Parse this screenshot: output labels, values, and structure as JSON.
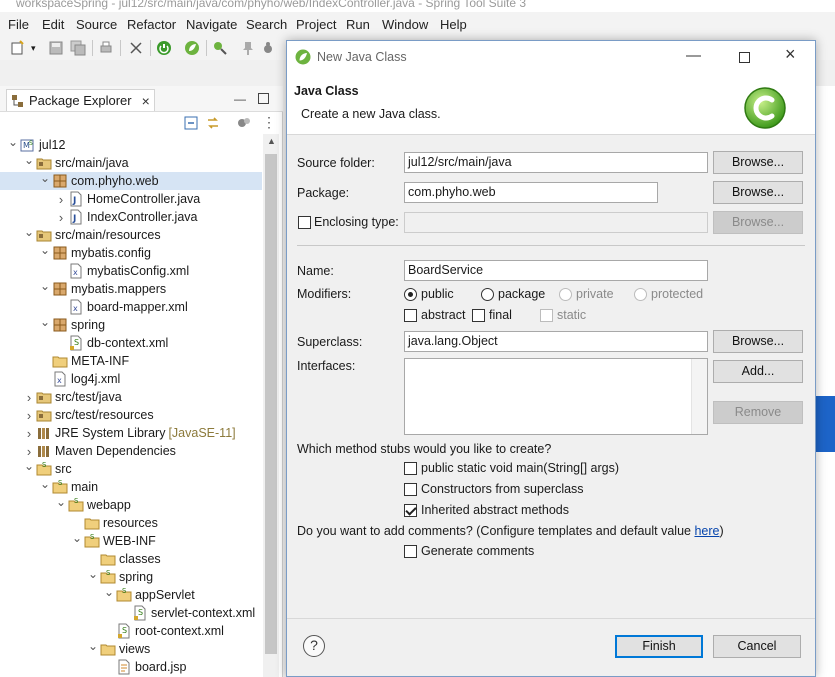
{
  "window": {
    "title": "workspaceSpring - jul12/src/main/java/com/phyho/web/IndexController.java - Spring Tool Suite 3"
  },
  "menu": [
    "File",
    "Edit",
    "Source",
    "Refactor",
    "Navigate",
    "Search",
    "Project",
    "Run",
    "Window",
    "Help"
  ],
  "explorer": {
    "tab_label": "Package Explorer",
    "tree": [
      {
        "label": "jul12",
        "icon": "spring-project-icon",
        "expanded": true
      },
      {
        "label": "src/main/java",
        "icon": "source-folder-icon",
        "expanded": true
      },
      {
        "label": "com.phyho.web",
        "icon": "package-icon",
        "expanded": true,
        "selected": true
      },
      {
        "label": "HomeController.java",
        "icon": "java-file-icon",
        "expanded": false
      },
      {
        "label": "IndexController.java",
        "icon": "java-file-icon",
        "expanded": false
      },
      {
        "label": "src/main/resources",
        "icon": "source-folder-icon",
        "expanded": true
      },
      {
        "label": "mybatis.config",
        "icon": "package-icon",
        "expanded": true
      },
      {
        "label": "mybatisConfig.xml",
        "icon": "xml-file-icon"
      },
      {
        "label": "mybatis.mappers",
        "icon": "package-icon",
        "expanded": true
      },
      {
        "label": "board-mapper.xml",
        "icon": "xml-file-icon"
      },
      {
        "label": "spring",
        "icon": "package-icon",
        "expanded": true
      },
      {
        "label": "db-context.xml",
        "icon": "spring-xml-icon"
      },
      {
        "label": "META-INF",
        "icon": "folder-icon"
      },
      {
        "label": "log4j.xml",
        "icon": "xml-file-icon"
      },
      {
        "label": "src/test/java",
        "icon": "source-folder-icon",
        "expanded": false
      },
      {
        "label": "src/test/resources",
        "icon": "source-folder-icon",
        "expanded": false
      },
      {
        "label": "JRE System Library",
        "decor": "[JavaSE-11]",
        "icon": "library-icon",
        "expanded": false
      },
      {
        "label": "Maven Dependencies",
        "icon": "library-icon",
        "expanded": false
      },
      {
        "label": "src",
        "icon": "spring-folder-icon",
        "expanded": true
      },
      {
        "label": "main",
        "icon": "spring-folder-icon",
        "expanded": true
      },
      {
        "label": "webapp",
        "icon": "spring-folder-icon",
        "expanded": true
      },
      {
        "label": "resources",
        "icon": "folder-icon"
      },
      {
        "label": "WEB-INF",
        "icon": "spring-folder-icon",
        "expanded": true
      },
      {
        "label": "classes",
        "icon": "folder-icon"
      },
      {
        "label": "spring",
        "icon": "spring-folder-icon",
        "expanded": true
      },
      {
        "label": "appServlet",
        "icon": "spring-folder-icon",
        "expanded": true
      },
      {
        "label": "servlet-context.xml",
        "icon": "spring-xml-icon"
      },
      {
        "label": "root-context.xml",
        "icon": "spring-xml-icon"
      },
      {
        "label": "views",
        "icon": "folder-icon",
        "expanded": true
      },
      {
        "label": "board.jsp",
        "icon": "jsp-file-icon"
      }
    ]
  },
  "dialog": {
    "title": "New Java Class",
    "header_title": "Java Class",
    "header_desc": "Create a new Java class.",
    "source_folder": {
      "label": "Source folder:",
      "value": "jul12/src/main/java",
      "button": "Browse..."
    },
    "package": {
      "label": "Package:",
      "value": "com.phyho.web",
      "button": "Browse..."
    },
    "enclosing": {
      "label": "Enclosing type:",
      "value": "",
      "button": "Browse..."
    },
    "name": {
      "label": "Name:",
      "value": "BoardService"
    },
    "modifiers": {
      "label": "Modifiers:",
      "public": "public",
      "package": "package",
      "private": "private",
      "protected": "protected",
      "abstract": "abstract",
      "final": "final",
      "static": "static"
    },
    "superclass": {
      "label": "Superclass:",
      "value": "java.lang.Object",
      "button": "Browse..."
    },
    "interfaces": {
      "label": "Interfaces:",
      "add": "Add...",
      "remove": "Remove"
    },
    "stubs": {
      "question": "Which method stubs would you like to create?",
      "main": "public static void main(String[] args)",
      "constructors": "Constructors from superclass",
      "inherited": "Inherited abstract methods"
    },
    "comments": {
      "question": "Do you want to add comments? (Configure templates and default value ",
      "link": "here",
      "close": ")",
      "generate": "Generate comments"
    },
    "help": "?",
    "finish": "Finish",
    "cancel": "Cancel"
  }
}
